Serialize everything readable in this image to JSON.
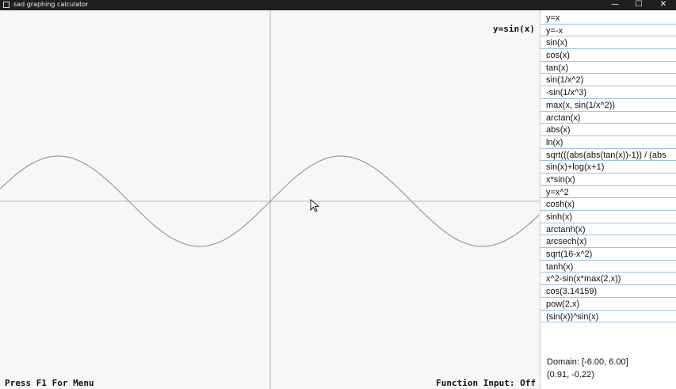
{
  "window": {
    "title": "sad graphing calculator",
    "minimize": "—",
    "maximize": "☐",
    "close": "✕"
  },
  "graph": {
    "function_label": "y=sin(x)",
    "menu_hint": "Press F1 For Menu",
    "function_input_status": "Function Input: Off",
    "function": "sin(x)",
    "domain": [
      -6,
      6
    ],
    "y_range": [
      -1,
      1
    ]
  },
  "functions": [
    "y=x",
    "y=-x",
    "sin(x)",
    "cos(x)",
    "tan(x)",
    "sin(1/x^2)",
    "-sin(1/x^3)",
    "max(x, sin(1/x^2))",
    "arctan(x)",
    "abs(x)",
    "ln(x)",
    "sqrt(((abs(abs(tan(x))-1)) / (abs",
    "sin(x)+log(x+1)",
    "x*sin(x)",
    "y=x^2",
    "cosh(x)",
    "sinh(x)",
    "arctanh(x)",
    "arcsech(x)",
    "sqrt(16-x^2)",
    "tanh(x)",
    "x^2-sin(x*max(2,x))",
    "cos(3.14159)",
    "pow(2,x)",
    "(sin(x))^sin(x)"
  ],
  "info": {
    "domain_text": "Domain: [-6.00, 6.00]",
    "cursor_coords": "(0.91, -0.22)"
  }
}
